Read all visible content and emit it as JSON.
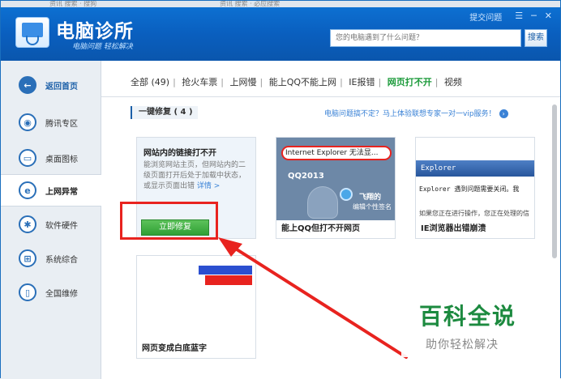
{
  "browser_tabs": [
    "资讯 搜索 · 搜狗",
    "资讯 搜索 · 必应搜索"
  ],
  "app": {
    "brand": "电脑诊所",
    "slogan": "电脑问题 轻松解决",
    "feedback_label": "提交问题",
    "search_placeholder": "您的电脑遇到了什么问题？",
    "search_button": "搜索"
  },
  "sidebar": {
    "items": [
      {
        "label": "返回首页",
        "icon": "back-arrow-icon"
      },
      {
        "label": "腾讯专区",
        "icon": "penguin-icon"
      },
      {
        "label": "桌面图标",
        "icon": "desktop-icon"
      },
      {
        "label": "上网异常",
        "icon": "ie-icon"
      },
      {
        "label": "软件硬件",
        "icon": "software-icon"
      },
      {
        "label": "系统综合",
        "icon": "windows-icon"
      },
      {
        "label": "全国维修",
        "icon": "phone-icon"
      }
    ]
  },
  "categories": [
    {
      "label": "全部 (49)"
    },
    {
      "label": "抢火车票"
    },
    {
      "label": "上网慢"
    },
    {
      "label": "能上QQ不能上网"
    },
    {
      "label": "IE报错"
    },
    {
      "label": "网页打不开"
    },
    {
      "label": "视频"
    }
  ],
  "section": {
    "title": "一键修复 ( 4 )",
    "ad": "电脑问题搞不定？马上体验联想专家一对一vip服务！"
  },
  "cards": [
    {
      "title": "网站内的链接打不开",
      "desc": "能浏览网站主页，但网站内的二级页面打开后处于加载中状态，或显示页面出错",
      "more": "详情 >",
      "button": "立即修复"
    },
    {
      "caption": "能上QQ但打不开网页",
      "ie_title": "Internet Explorer 无法显...",
      "qq": "QQ2013",
      "fly": "飞翔的",
      "sig": "编辑个性签名"
    },
    {
      "caption": "IE浏览器出错崩溃",
      "bar": "Explorer",
      "msg": "Explorer 遇到问题需要关闭。我",
      "msg2": "如果您正在进行操作，您正在处理的信"
    },
    {
      "caption": "网页变成白底蓝字"
    }
  ],
  "watermark": {
    "big": "百科全说",
    "small": "助你轻松解决"
  },
  "colors": {
    "title_blue": "#0a5fbf",
    "active_green": "#1b9a3a",
    "highlight_red": "#e8231f",
    "fix_button_green": "#2f9f35"
  }
}
